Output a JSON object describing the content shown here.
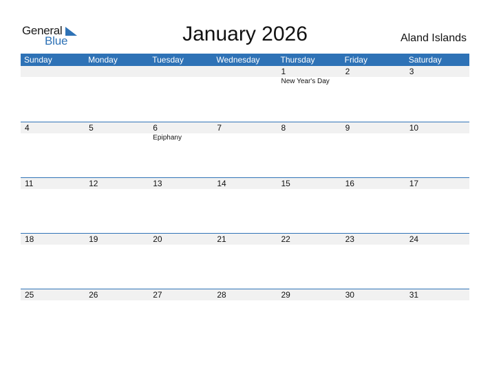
{
  "logo": {
    "line1": "General",
    "line2": "Blue",
    "icon": "triangle-flag-icon"
  },
  "title": "January 2026",
  "country": "Aland Islands",
  "colors": {
    "accent": "#2e72b6",
    "band": "#f1f1f1"
  },
  "weekdays": [
    "Sunday",
    "Monday",
    "Tuesday",
    "Wednesday",
    "Thursday",
    "Friday",
    "Saturday"
  ],
  "weeks": [
    [
      {
        "day": "",
        "event": ""
      },
      {
        "day": "",
        "event": ""
      },
      {
        "day": "",
        "event": ""
      },
      {
        "day": "",
        "event": ""
      },
      {
        "day": "1",
        "event": "New Year's Day"
      },
      {
        "day": "2",
        "event": ""
      },
      {
        "day": "3",
        "event": ""
      }
    ],
    [
      {
        "day": "4",
        "event": ""
      },
      {
        "day": "5",
        "event": ""
      },
      {
        "day": "6",
        "event": "Epiphany"
      },
      {
        "day": "7",
        "event": ""
      },
      {
        "day": "8",
        "event": ""
      },
      {
        "day": "9",
        "event": ""
      },
      {
        "day": "10",
        "event": ""
      }
    ],
    [
      {
        "day": "11",
        "event": ""
      },
      {
        "day": "12",
        "event": ""
      },
      {
        "day": "13",
        "event": ""
      },
      {
        "day": "14",
        "event": ""
      },
      {
        "day": "15",
        "event": ""
      },
      {
        "day": "16",
        "event": ""
      },
      {
        "day": "17",
        "event": ""
      }
    ],
    [
      {
        "day": "18",
        "event": ""
      },
      {
        "day": "19",
        "event": ""
      },
      {
        "day": "20",
        "event": ""
      },
      {
        "day": "21",
        "event": ""
      },
      {
        "day": "22",
        "event": ""
      },
      {
        "day": "23",
        "event": ""
      },
      {
        "day": "24",
        "event": ""
      }
    ],
    [
      {
        "day": "25",
        "event": ""
      },
      {
        "day": "26",
        "event": ""
      },
      {
        "day": "27",
        "event": ""
      },
      {
        "day": "28",
        "event": ""
      },
      {
        "day": "29",
        "event": ""
      },
      {
        "day": "30",
        "event": ""
      },
      {
        "day": "31",
        "event": ""
      }
    ]
  ]
}
